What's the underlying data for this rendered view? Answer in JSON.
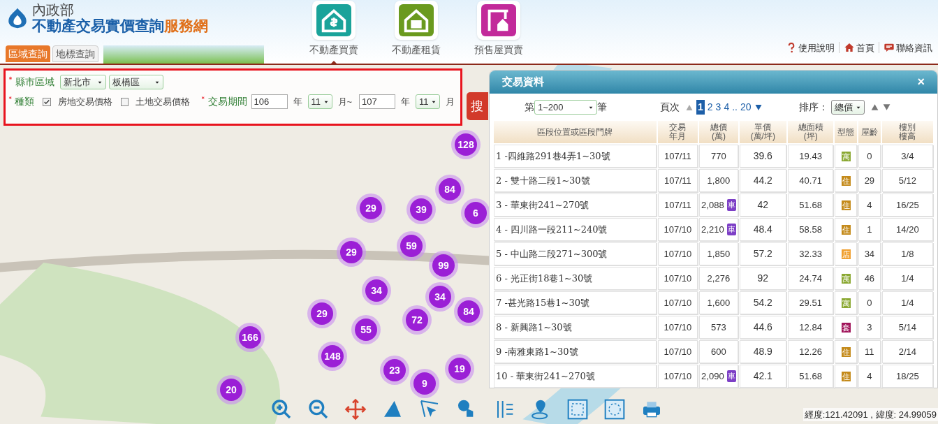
{
  "header": {
    "ministry": "內政部",
    "site_title": "不動產交易實價查詢",
    "site_suffix": "服務網",
    "search_tabs": [
      {
        "label": "區域查詢",
        "selected": true
      },
      {
        "label": "地標查詢",
        "selected": false
      }
    ],
    "nav": [
      {
        "kind": "sale",
        "label": "不動產買賣",
        "selected": true
      },
      {
        "kind": "rent",
        "label": "不動產租賃",
        "selected": false
      },
      {
        "kind": "presale",
        "label": "預售屋買賣",
        "selected": false
      }
    ],
    "links": [
      {
        "kind": "help",
        "label": "使用說明"
      },
      {
        "kind": "home",
        "label": "首頁"
      },
      {
        "kind": "contact",
        "label": "聯絡資訊"
      }
    ]
  },
  "filter": {
    "region_label": "縣市區域",
    "city": "新北市",
    "district": "板橋區",
    "type_label": "種類",
    "types": [
      {
        "label": "房地交易價格",
        "checked": true
      },
      {
        "label": "土地交易價格",
        "checked": false
      }
    ],
    "period_label": "交易期間",
    "from_year": "106",
    "year_unit": "年",
    "from_month": "11",
    "month_to": "月~",
    "to_year": "107",
    "year_unit_2": "年",
    "to_month": "11",
    "month_unit": "月",
    "search_button": "搜"
  },
  "map": {
    "clusters": [
      "128",
      "84",
      "29",
      "39",
      "6",
      "29",
      "59",
      "99",
      "34",
      "34",
      "29",
      "55",
      "72",
      "84",
      "166",
      "148",
      "23",
      "19",
      "9",
      "20"
    ],
    "coordinates": "經度:121.42091 , 緯度: 24.99059"
  },
  "panel": {
    "title": "交易資料",
    "close": "×",
    "range_prefix": "第",
    "range": "1~200",
    "range_suffix": "筆",
    "page_label": "頁次",
    "pages": [
      {
        "label": "1",
        "selected": true
      },
      {
        "label": "2",
        "selected": false
      },
      {
        "label": "3",
        "selected": false
      },
      {
        "label": "4",
        "selected": false
      },
      {
        "label": "..",
        "selected": false
      },
      {
        "label": "20",
        "selected": false
      }
    ],
    "sort_label": "排序：",
    "sort": "總價",
    "columns": [
      [
        "區段位置或區段門牌"
      ],
      [
        "交易",
        "年月"
      ],
      [
        "總價",
        "(萬)"
      ],
      [
        "單價",
        "(萬/坪)"
      ],
      [
        "總面積",
        "(坪)"
      ],
      [
        "型態"
      ],
      [
        "屋齡"
      ],
      [
        "樓別",
        "樓高"
      ]
    ],
    "rows": [
      {
        "location": "1 -四維路291巷4弄1~30號",
        "date": "107/11",
        "total": "770",
        "unit": "39.6",
        "area": "19.43",
        "type": "寓",
        "color": "#8aa832",
        "age": "0",
        "floor": "3/4"
      },
      {
        "location": "2 - 雙十路二段1~30號",
        "date": "107/11",
        "total": "1,800",
        "unit": "44.2",
        "area": "40.71",
        "type": "住",
        "color": "#c48a1a",
        "age": "29",
        "floor": "5/12"
      },
      {
        "location": "3 - 華東街241~270號",
        "date": "107/11",
        "total": "2,088",
        "parking": "車",
        "unit": "42",
        "area": "51.68",
        "type": "住",
        "color": "#c48a1a",
        "age": "4",
        "floor": "16/25"
      },
      {
        "location": "4 - 四川路一段211~240號",
        "date": "107/10",
        "total": "2,210",
        "parking": "車",
        "unit": "48.4",
        "area": "58.58",
        "type": "住",
        "color": "#c48a1a",
        "age": "1",
        "floor": "14/20"
      },
      {
        "location": "5 - 中山路二段271~300號",
        "date": "107/10",
        "total": "1,850",
        "unit": "57.2",
        "area": "32.33",
        "type": "店",
        "color": "#f0a030",
        "age": "34",
        "floor": "1/8"
      },
      {
        "location": "6 - 光正街18巷1~30號",
        "date": "107/10",
        "total": "2,276",
        "unit": "92",
        "area": "24.74",
        "type": "寓",
        "color": "#8aa832",
        "age": "46",
        "floor": "1/4"
      },
      {
        "location": "7 -甚光路15巷1~30號",
        "date": "107/10",
        "total": "1,600",
        "unit": "54.2",
        "area": "29.51",
        "type": "寓",
        "color": "#8aa832",
        "age": "0",
        "floor": "1/4"
      },
      {
        "location": "8 - 新興路1~30號",
        "date": "107/10",
        "total": "573",
        "unit": "44.6",
        "area": "12.84",
        "type": "套",
        "color": "#a0145a",
        "age": "3",
        "floor": "5/14"
      },
      {
        "location": "9 -南雅東路1~30號",
        "date": "107/10",
        "total": "600",
        "unit": "48.9",
        "area": "12.26",
        "type": "住",
        "color": "#c48a1a",
        "age": "11",
        "floor": "2/14"
      },
      {
        "location": "10 - 華東街241~270號",
        "date": "107/10",
        "total": "2,090",
        "parking": "車",
        "unit": "42.1",
        "area": "51.68",
        "type": "住",
        "color": "#c48a1a",
        "age": "4",
        "floor": "18/25"
      }
    ]
  },
  "toolbar": [
    {
      "kind": "zoom-in"
    },
    {
      "kind": "zoom-out"
    },
    {
      "kind": "pan"
    },
    {
      "kind": "measure-area"
    },
    {
      "kind": "select"
    },
    {
      "kind": "pointer"
    },
    {
      "kind": "grid"
    },
    {
      "kind": "locate"
    },
    {
      "kind": "box-select"
    },
    {
      "kind": "circle-select"
    },
    {
      "kind": "print"
    }
  ]
}
